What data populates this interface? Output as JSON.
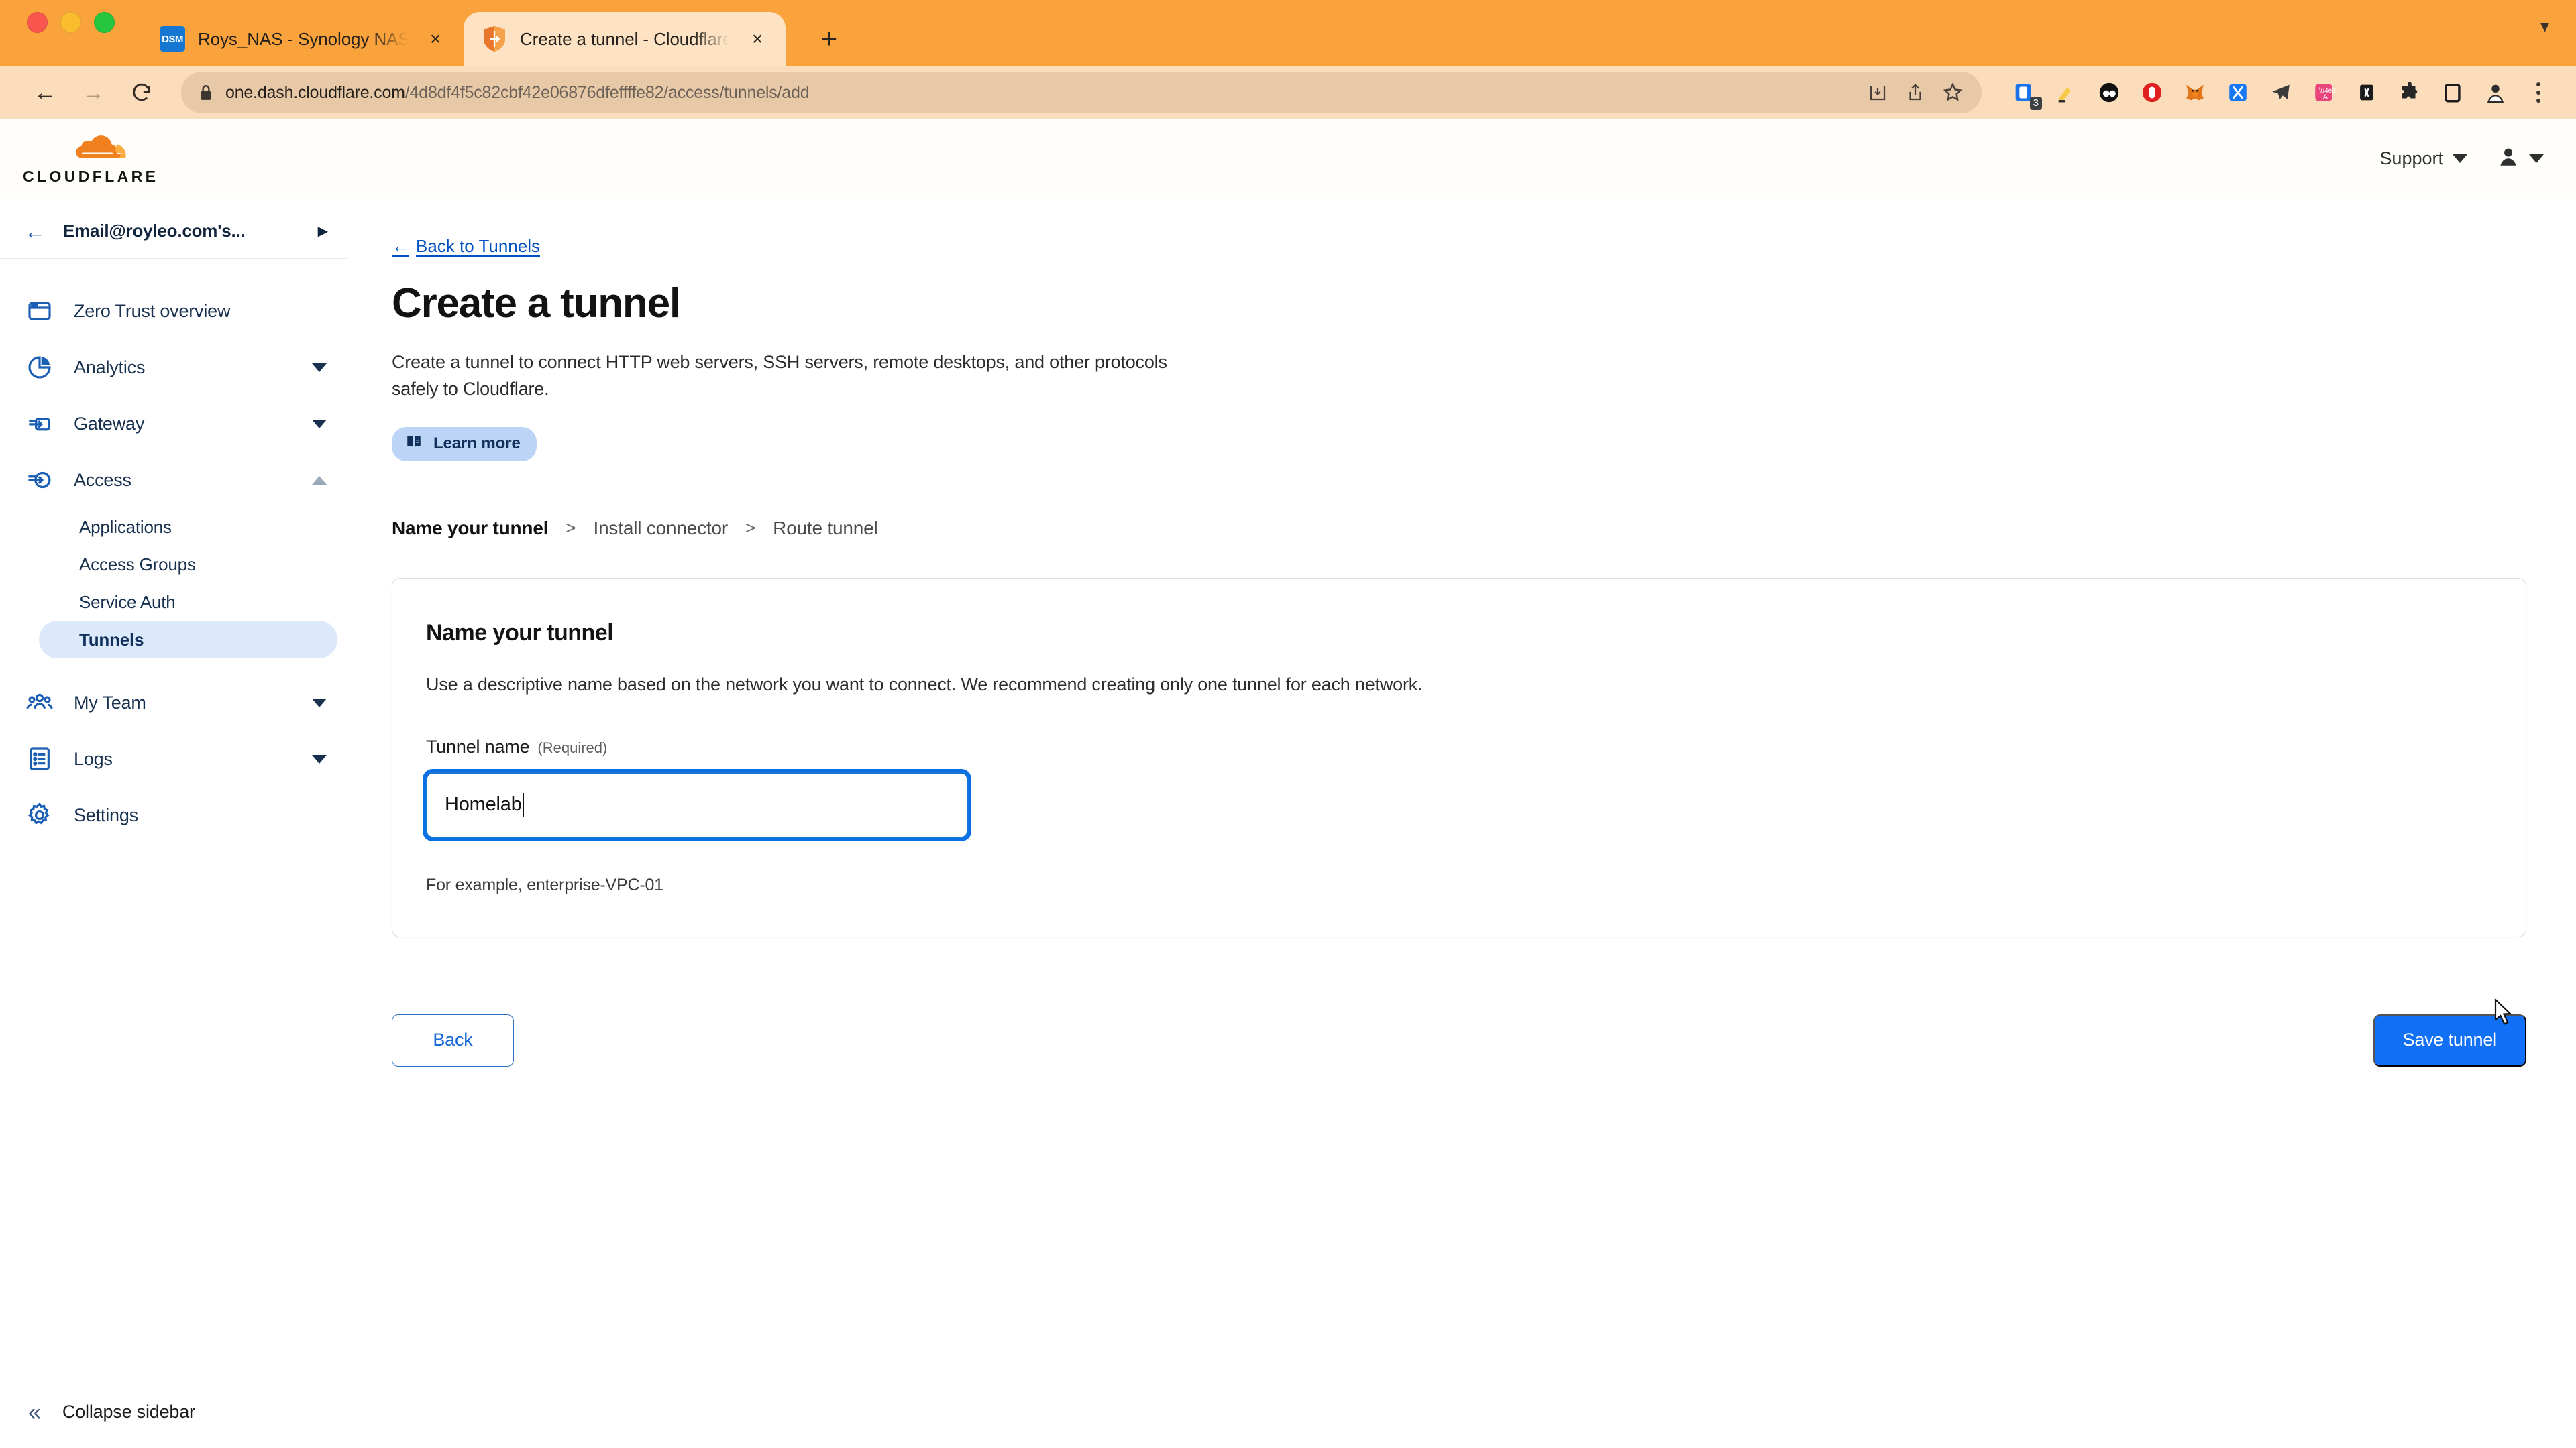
{
  "browser": {
    "traffic_lights": [
      "close",
      "minimize",
      "maximize"
    ],
    "tabs": [
      {
        "title": "Roys_NAS - Synology NAS",
        "favicon": "dsm-favicon",
        "active": false,
        "close_label": "×"
      },
      {
        "title": "Create a tunnel - Cloudflare Ze",
        "favicon": "cloudflare-shield-favicon",
        "active": true,
        "close_label": "×"
      }
    ],
    "new_tab_label": "+",
    "tabstrip_menu_icon": "chevron-down-icon",
    "nav": {
      "back": "←",
      "forward": "→",
      "reload": "⟳"
    },
    "omnibox": {
      "lock_icon": "lock-icon",
      "host": "one.dash.cloudflare.com",
      "path": "/4d8df4f5c82cbf42e06876dfeffffe82/access/tunnels/add",
      "full_url": "one.dash.cloudflare.com/4d8df4f5c82cbf42e06876dfeffffe82/access/tunnels/add",
      "actions": [
        "install-app-icon",
        "share-icon",
        "bookmark-star-icon"
      ]
    },
    "extensions": [
      {
        "name": "pocket-extension-icon",
        "badge": "3"
      },
      {
        "name": "highlighter-extension-icon",
        "badge": ""
      },
      {
        "name": "dark-reader-extension-icon",
        "badge": ""
      },
      {
        "name": "adblock-extension-icon",
        "badge": ""
      },
      {
        "name": "metamask-fox-extension-icon",
        "badge": ""
      },
      {
        "name": "blue-arrow-extension-icon",
        "badge": ""
      },
      {
        "name": "telegram-extension-icon",
        "badge": ""
      },
      {
        "name": "translate-extension-icon",
        "badge": ""
      },
      {
        "name": "bracket-extension-icon",
        "badge": ""
      },
      {
        "name": "puzzle-extensions-icon",
        "badge": ""
      },
      {
        "name": "sidebar-toggle-icon",
        "badge": ""
      },
      {
        "name": "profile-avatar-icon",
        "badge": ""
      }
    ],
    "menu_icon": "kebab-menu-icon"
  },
  "header": {
    "logo_wordmark": "CLOUDFLARE",
    "logo_icon": "cloudflare-cloud-logo",
    "support_label": "Support",
    "support_caret": "chevron-down-icon",
    "account_icon": "user-avatar-icon",
    "account_caret": "chevron-down-icon"
  },
  "sidebar": {
    "back_icon": "arrow-left-icon",
    "account_name": "Email@royleo.com's...",
    "account_caret": "chevron-right-icon",
    "items": [
      {
        "label": "Zero Trust overview",
        "icon": "browser-window-icon",
        "expandable": false,
        "expanded": false
      },
      {
        "label": "Analytics",
        "icon": "pie-chart-icon",
        "expandable": true,
        "expanded": false
      },
      {
        "label": "Gateway",
        "icon": "gateway-arrow-icon",
        "expandable": true,
        "expanded": false
      },
      {
        "label": "Access",
        "icon": "access-arrow-circle-icon",
        "expandable": true,
        "expanded": true
      },
      {
        "label": "My Team",
        "icon": "users-group-icon",
        "expandable": true,
        "expanded": false
      },
      {
        "label": "Logs",
        "icon": "log-list-icon",
        "expandable": true,
        "expanded": false
      },
      {
        "label": "Settings",
        "icon": "gear-icon",
        "expandable": false,
        "expanded": false
      }
    ],
    "access_subitems": [
      {
        "label": "Applications",
        "selected": false
      },
      {
        "label": "Access Groups",
        "selected": false
      },
      {
        "label": "Service Auth",
        "selected": false
      },
      {
        "label": "Tunnels",
        "selected": true
      }
    ],
    "collapse_label": "Collapse sidebar",
    "collapse_icon": "double-chevron-left-icon"
  },
  "main": {
    "back_link": "Back to Tunnels",
    "back_link_arrow": "←",
    "title": "Create a tunnel",
    "description": "Create a tunnel to connect HTTP web servers, SSH servers, remote desktops, and other protocols safely to Cloudflare.",
    "learn_more": {
      "label": "Learn more",
      "icon": "book-icon"
    },
    "steps": [
      {
        "label": "Name your tunnel",
        "current": true
      },
      {
        "label": "Install connector",
        "current": false
      },
      {
        "label": "Route tunnel",
        "current": false
      }
    ],
    "step_separator": ">",
    "card": {
      "title": "Name your tunnel",
      "description": "Use a descriptive name based on the network you want to connect. We recommend creating only one tunnel for each network.",
      "field_label": "Tunnel name",
      "field_required": "(Required)",
      "field_value": "Homelab",
      "field_placeholder": "",
      "field_hint": "For example, enterprise-VPC-01"
    },
    "buttons": {
      "back": "Back",
      "save": "Save tunnel"
    }
  },
  "colors": {
    "browser_orange": "#faa23c",
    "browser_toolbar": "#fbdcbb",
    "active_tab": "#fde3c3",
    "cf_orange": "#f6821f",
    "accent_blue": "#1170f5",
    "link_blue": "#0051c3",
    "sidebar_navy": "#17314f",
    "selected_bg": "#dce9fb",
    "learn_pill_bg": "#bcd5f7"
  }
}
